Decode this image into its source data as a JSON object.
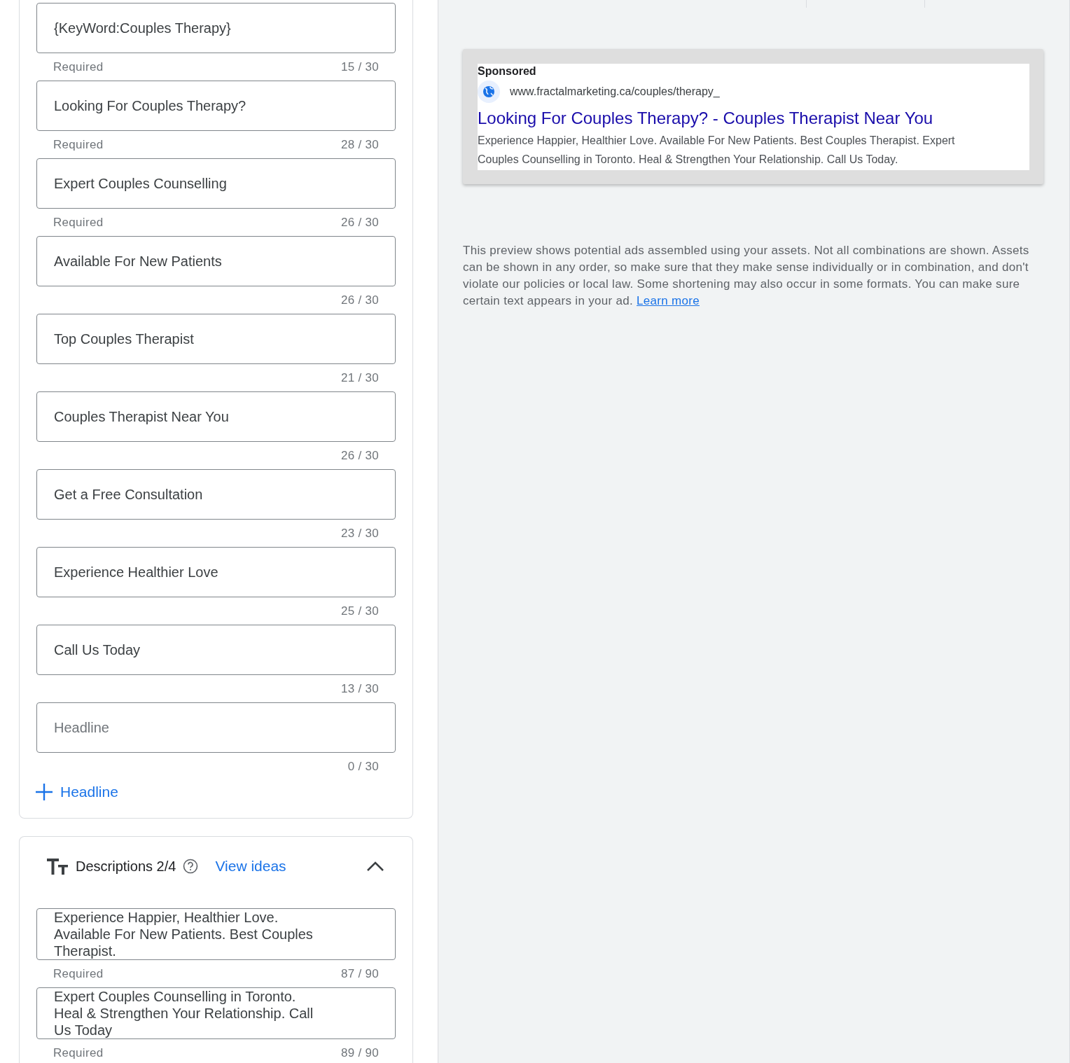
{
  "headlines": [
    {
      "value": "{KeyWord:Couples Therapy}",
      "helper": "Required",
      "counter": "15 / 30"
    },
    {
      "value": "Looking For Couples Therapy?",
      "helper": "Required",
      "counter": "28 / 30"
    },
    {
      "value": "Expert Couples Counselling",
      "helper": "Required",
      "counter": "26 / 30"
    },
    {
      "value": "Available For New Patients",
      "counter": "26 / 30"
    },
    {
      "value": "Top Couples Therapist",
      "counter": "21 / 30"
    },
    {
      "value": "Couples Therapist Near You",
      "counter": "26 / 30"
    },
    {
      "value": "Get a Free Consultation",
      "counter": "23 / 30"
    },
    {
      "value": "Experience Healthier Love",
      "counter": "25 / 30"
    },
    {
      "value": "Call Us Today",
      "counter": "13 / 30"
    },
    {
      "placeholder": "Headline",
      "counter": "0 / 30"
    }
  ],
  "add_headline": {
    "label": "Headline"
  },
  "descriptions_section": {
    "title": "Descriptions 2/4",
    "view_ideas": "View ideas",
    "expanded": true,
    "fields": [
      {
        "value": "Experience Happier, Healthier Love. Available For New Patients. Best Couples Therapist.",
        "helper": "Required",
        "counter": "87 / 90"
      },
      {
        "value": "Expert Couples Counselling in Toronto. Heal & Strengthen Your Relationship. Call Us Today",
        "helper": "Required",
        "counter": "89 / 90"
      }
    ]
  },
  "ad_preview": {
    "label": "Sponsored",
    "url": "www.fractalmarketing.ca/couples/therapy_",
    "headline": "Looking For Couples Therapy? - Couples Therapist Near You",
    "description": "Experience Happier, Healthier Love. Available For New Patients. Best Couples Therapist. Expert Couples Counselling in Toronto. Heal & Strengthen Your Relationship. Call Us Today."
  },
  "preview_note": {
    "text": "This preview shows potential ads assembled using your assets. Not all combinations are shown. Assets can be shown in any order, so make sure that they make sense individually or in combination, and don't violate our policies or local law. Some shortening may also occur in some formats. You can make sure certain text appears in your ad.",
    "link": "Learn more"
  }
}
